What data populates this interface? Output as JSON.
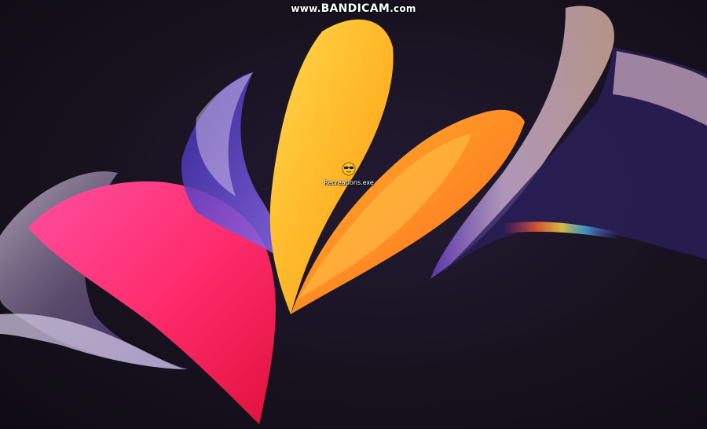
{
  "watermark": {
    "prefix": "www.",
    "brand": "BANDICAM",
    "suffix": ".com"
  },
  "desktop": {
    "icons": [
      {
        "label": "Recreations.exe",
        "icon": "sunglasses-face-icon"
      }
    ]
  },
  "colors": {
    "background": "#17121f",
    "pink": "#ff2d7a",
    "orange": "#ff9a1f",
    "yellow": "#ffc93a",
    "violet": "#5b3fd6",
    "glass": "#e9d7f2"
  }
}
